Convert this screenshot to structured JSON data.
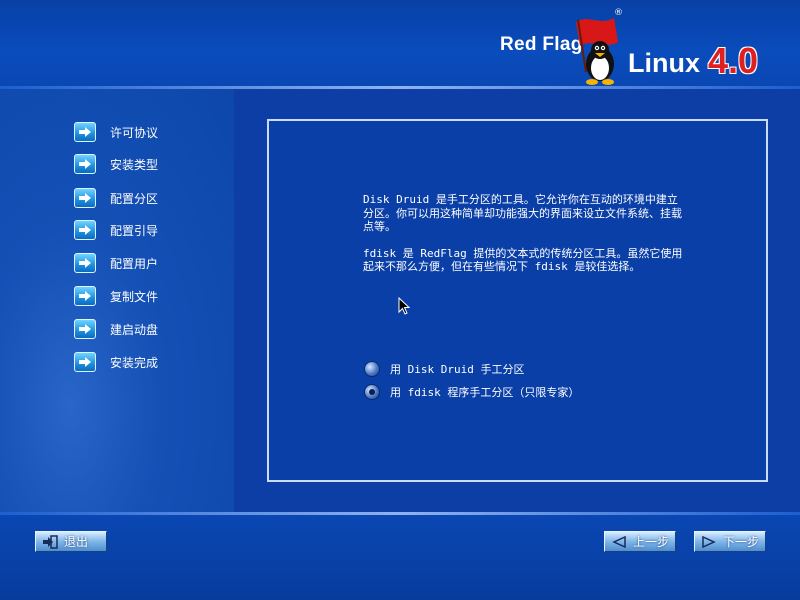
{
  "logo": {
    "brand": "Red Flag",
    "product": "Linux",
    "version": "4.0",
    "registered_mark": "®"
  },
  "sidebar": {
    "items": [
      {
        "label": "许可协议",
        "icon": "arrow-right-icon"
      },
      {
        "label": "安装类型",
        "icon": "arrow-right-icon"
      },
      {
        "label": "配置分区",
        "icon": "arrow-right-icon"
      },
      {
        "label": "配置引导",
        "icon": "arrow-right-icon"
      },
      {
        "label": "配置用户",
        "icon": "arrow-right-icon"
      },
      {
        "label": "复制文件",
        "icon": "arrow-right-icon"
      },
      {
        "label": "建启动盘",
        "icon": "arrow-right-icon"
      },
      {
        "label": "安装完成",
        "icon": "arrow-right-icon"
      }
    ]
  },
  "main": {
    "paragraph1": "Disk Druid 是手工分区的工具。它允许你在互动的环境中建立分区。你可以用这种简单却功能强大的界面来设立文件系统、挂载点等。",
    "paragraph2": "fdisk 是 RedFlag 提供的文本式的传统分区工具。虽然它使用起来不那么方便，但在有些情况下 fdisk 是较佳选择。",
    "options": [
      {
        "label": "用 Disk Druid 手工分区",
        "selected": false
      },
      {
        "label": "用 fdisk 程序手工分区（只限专家）",
        "selected": true
      }
    ]
  },
  "footer": {
    "exit_label": "退出",
    "back_label": "上一步",
    "next_label": "下一步"
  },
  "colors": {
    "background": "#0a3d9e",
    "panel_border": "#c9dcff",
    "version_red": "#e02020"
  }
}
